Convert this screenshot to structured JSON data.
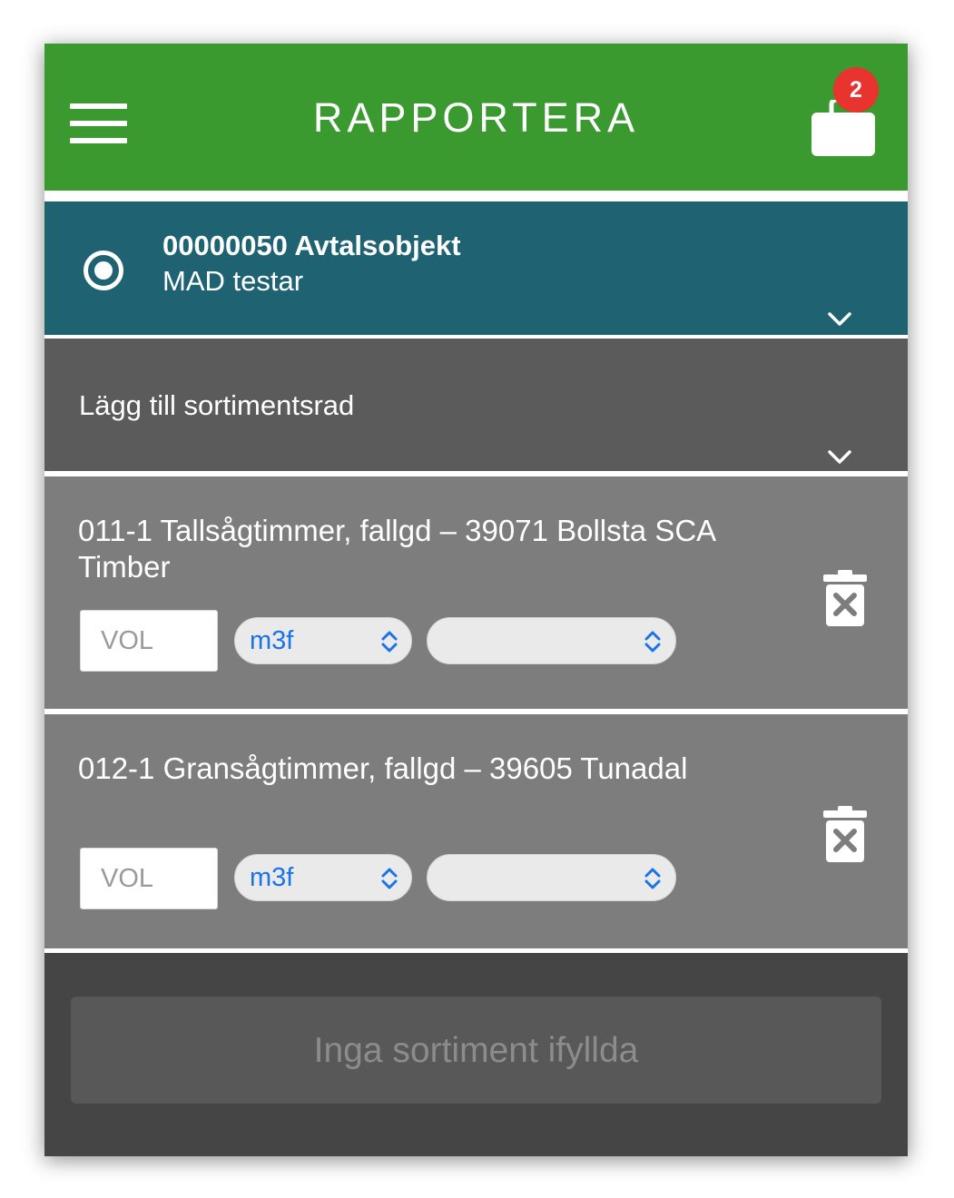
{
  "header": {
    "title": "RAPPORTERA",
    "menu_icon": "hamburger-menu-icon",
    "cart_icon": "shopping-bag-icon",
    "cart_badge": "2",
    "background_color": "#3a9a2f",
    "badge_color": "#e8332f"
  },
  "object_selector": {
    "title": "00000050 Avtalsobjekt",
    "subtitle": "MAD testar",
    "icon": "radio-selected-icon",
    "expand_icon": "chevron-down-icon",
    "background_color": "#1f6373"
  },
  "add_row": {
    "label": "Lägg till sortimentsrad",
    "expand_icon": "chevron-down-icon",
    "background_color": "#5b5b5b"
  },
  "items": [
    {
      "title": "011-1 Tallsågtimmer, fallgd – 39071 Bollsta SCA Timber",
      "vol_placeholder": "VOL",
      "unit_value": "m3f",
      "second_select_value": "",
      "delete_icon": "trash-icon"
    },
    {
      "title": "012-1 Gransågtimmer, fallgd – 39605 Tunadal",
      "vol_placeholder": "VOL",
      "unit_value": "m3f",
      "second_select_value": "",
      "delete_icon": "trash-icon"
    }
  ],
  "footer": {
    "button_label": "Inga sortiment ifyllda",
    "button_state": "disabled"
  }
}
